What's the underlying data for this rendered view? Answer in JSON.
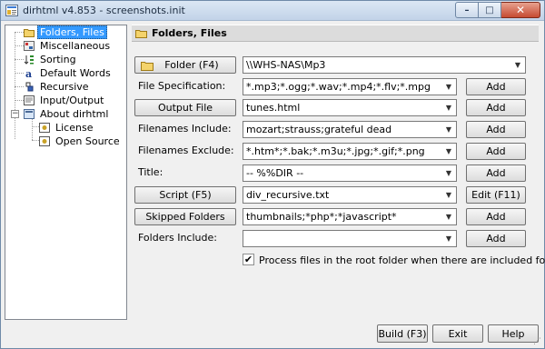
{
  "window": {
    "title": "dirhtml v4.853 - screenshots.init",
    "min_glyph": "–",
    "max_glyph": "□",
    "close_glyph": "✕"
  },
  "tree": {
    "items": [
      {
        "label": "Folders, Files",
        "icon": "folder-icon",
        "selected": true
      },
      {
        "label": "Miscellaneous",
        "icon": "misc-icon"
      },
      {
        "label": "Sorting",
        "icon": "sort-icon"
      },
      {
        "label": "Default Words",
        "icon": "words-icon"
      },
      {
        "label": "Recursive",
        "icon": "recursive-icon"
      },
      {
        "label": "Input/Output",
        "icon": "io-icon"
      },
      {
        "label": "About dirhtml",
        "icon": "about-icon",
        "expander": "−"
      },
      {
        "label": "License",
        "icon": "license-icon"
      },
      {
        "label": "Open Source",
        "icon": "opensource-icon"
      }
    ]
  },
  "panel": {
    "title": "Folders, Files"
  },
  "form": {
    "folder_button": "Folder (F4)",
    "folder_value": "\\\\WHS-NAS\\Mp3",
    "file_spec_label": "File Specification:",
    "file_spec_value": "*.mp3;*.ogg;*.wav;*.mp4;*.flv;*.mpg",
    "output_button": "Output File",
    "output_value": "tunes.html",
    "include_label": "Filenames Include:",
    "include_value": "mozart;strauss;grateful dead",
    "exclude_label": "Filenames Exclude:",
    "exclude_value": "*.htm*;*.bak;*.m3u;*.jpg;*.gif;*.png",
    "title_label": "Title:",
    "title_value": "-- %%DIR --",
    "script_button": "Script (F5)",
    "script_value": "div_recursive.txt",
    "skipped_button": "Skipped Folders",
    "skipped_value": "thumbnails;*php*;*javascript*",
    "folders_include_label": "Folders Include:",
    "folders_include_value": "",
    "add_label": "Add",
    "edit_label": "Edit (F11)",
    "root_checkbox_label": "Process files in the root folder when there are included folders",
    "root_checkbox_checked": "✔",
    "dropdown_glyph": "▼"
  },
  "footer": {
    "build_button": "Build (F3)",
    "exit_button": "Exit",
    "help_button": "Help",
    "grip_glyph": "⋰"
  }
}
